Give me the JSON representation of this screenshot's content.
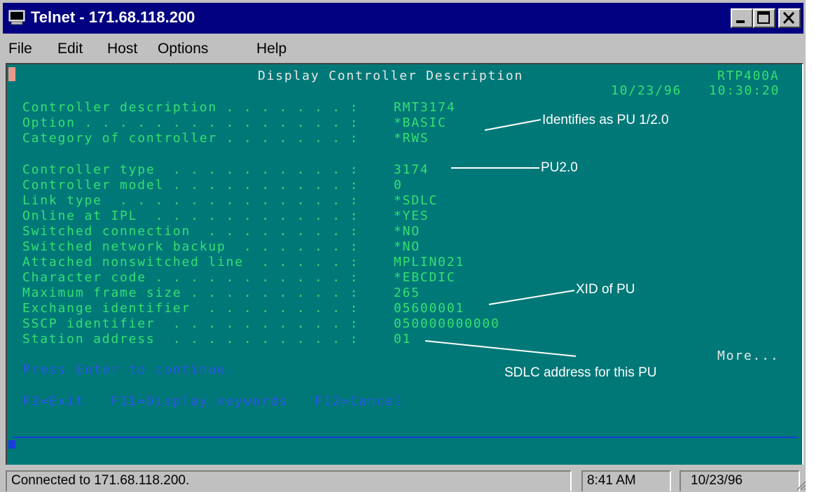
{
  "window": {
    "title": "Telnet - 171.68.118.200",
    "icon": "monitor-icon"
  },
  "menu": {
    "items": [
      "File",
      "Edit",
      "Host",
      "Options",
      "Help"
    ]
  },
  "terminal": {
    "header_title": "Display Controller Description",
    "system_name": "RTP400A",
    "date": "10/23/96",
    "time": "10:30:20",
    "fields": [
      {
        "label": "Controller description . . . . . . . :",
        "value": "RMT3174"
      },
      {
        "label": "Option . . . . . . . . . . . . . . . :",
        "value": "*BASIC"
      },
      {
        "label": "Category of controller . . . . . . . :",
        "value": "*RWS"
      },
      {
        "label": "Controller type  . . . . . . . . . . :",
        "value": "3174"
      },
      {
        "label": "Controller model . . . . . . . . . . :",
        "value": "0"
      },
      {
        "label": "Link type  . . . . . . . . . . . . . :",
        "value": "*SDLC"
      },
      {
        "label": "Online at IPL  . . . . . . . . . . . :",
        "value": "*YES"
      },
      {
        "label": "Switched connection  . . . . . . . . :",
        "value": "*NO"
      },
      {
        "label": "Switched network backup  . . . . . . :",
        "value": "*NO"
      },
      {
        "label": "Attached nonswitched line  . . . . . :",
        "value": "MPLIN021"
      },
      {
        "label": "Character code . . . . . . . . . . . :",
        "value": "*EBCDIC"
      },
      {
        "label": "Maximum frame size . . . . . . . . . :",
        "value": "265"
      },
      {
        "label": "Exchange identifier  . . . . . . . . :",
        "value": "05600001"
      },
      {
        "label": "SSCP identifier  . . . . . . . . . . :",
        "value": "050000000000"
      },
      {
        "label": "Station address  . . . . . . . . . . :",
        "value": "01"
      }
    ],
    "more": "More...",
    "prompt": "Press Enter to continue.",
    "function_keys": "F3=Exit   F11=Display keywords   F12=Cancel"
  },
  "annotations": {
    "identifies": "Identifies as PU 1/2.0",
    "pu20": "PU2.0",
    "xid": "XID of PU",
    "sdlc": "SDLC address for this PU"
  },
  "status": {
    "connection": "Connected to 171.68.118.200.",
    "time": "8:41 AM",
    "date": "10/23/96"
  },
  "colors": {
    "terminal_bg": "#007878",
    "field_text": "#35e070",
    "highlight_text": "#2a56e8",
    "title_bar": "#000080"
  }
}
